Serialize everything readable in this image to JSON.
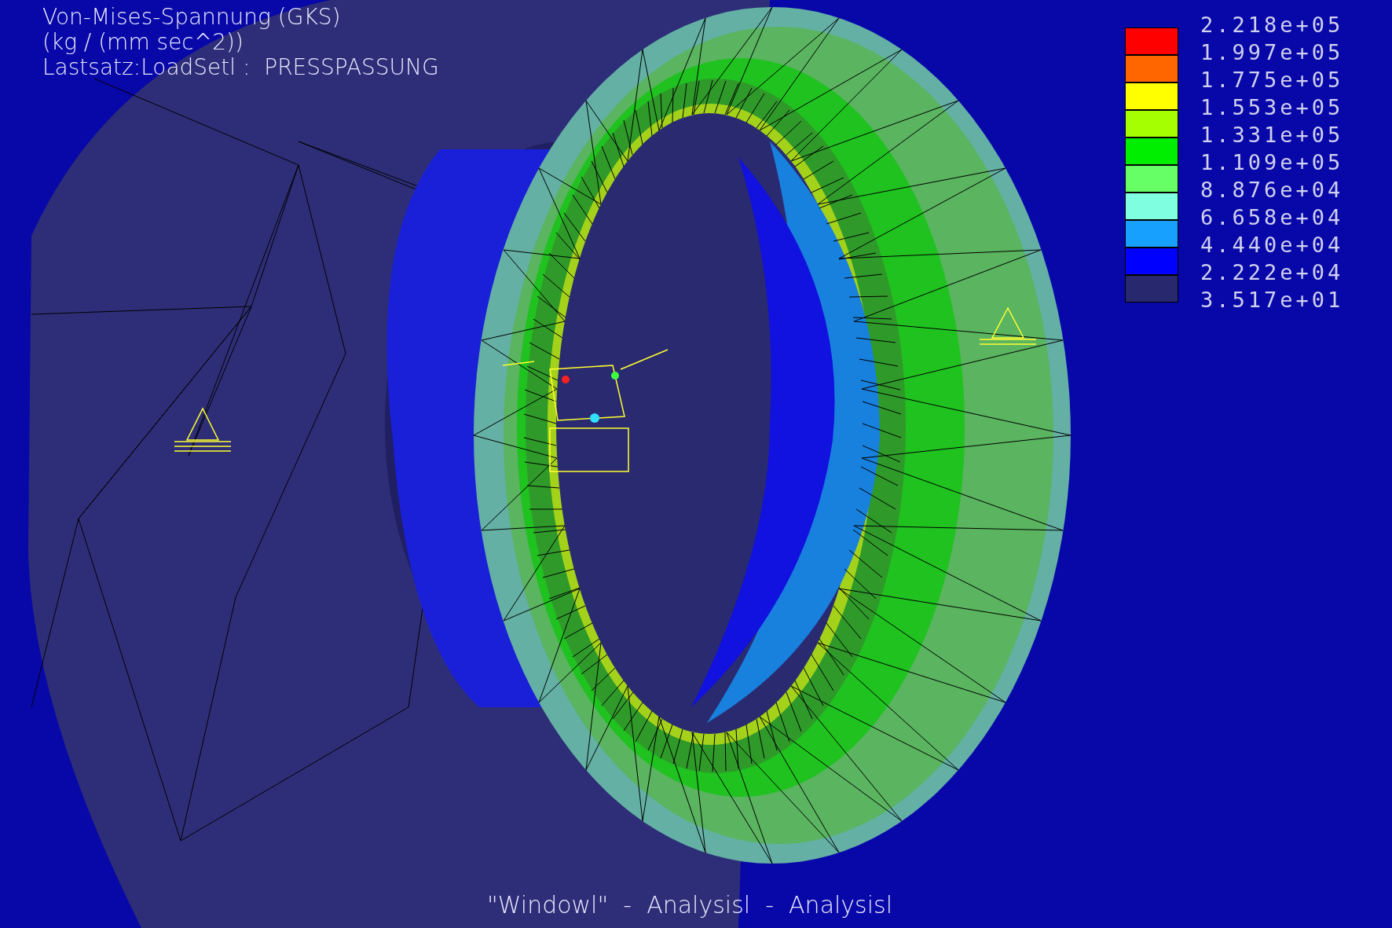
{
  "title_lines": [
    "Von-Mises-Spannung (GKS)",
    "(kg / (mm sec^2))",
    "Lastsatz:LoadSetl :  PRESSPASSUNG"
  ],
  "legend": [
    {
      "value": "2.218e+05",
      "color": "#ff0000"
    },
    {
      "value": "1.997e+05",
      "color": "#ff6600"
    },
    {
      "value": "1.775e+05",
      "color": "#ffff00"
    },
    {
      "value": "1.553e+05",
      "color": "#a6ff00"
    },
    {
      "value": "1.331e+05",
      "color": "#00ee00"
    },
    {
      "value": "1.109e+05",
      "color": "#66ff66"
    },
    {
      "value": "8.876e+04",
      "color": "#80ffe0"
    },
    {
      "value": "6.658e+04",
      "color": "#18a0ff"
    },
    {
      "value": "4.440e+04",
      "color": "#0000ff"
    },
    {
      "value": "2.222e+04",
      "color": "#28286e"
    },
    {
      "value": "3.517e+01"
    }
  ],
  "caption": "\"Windowl\"  -  Analysisl  -  Analysisl"
}
